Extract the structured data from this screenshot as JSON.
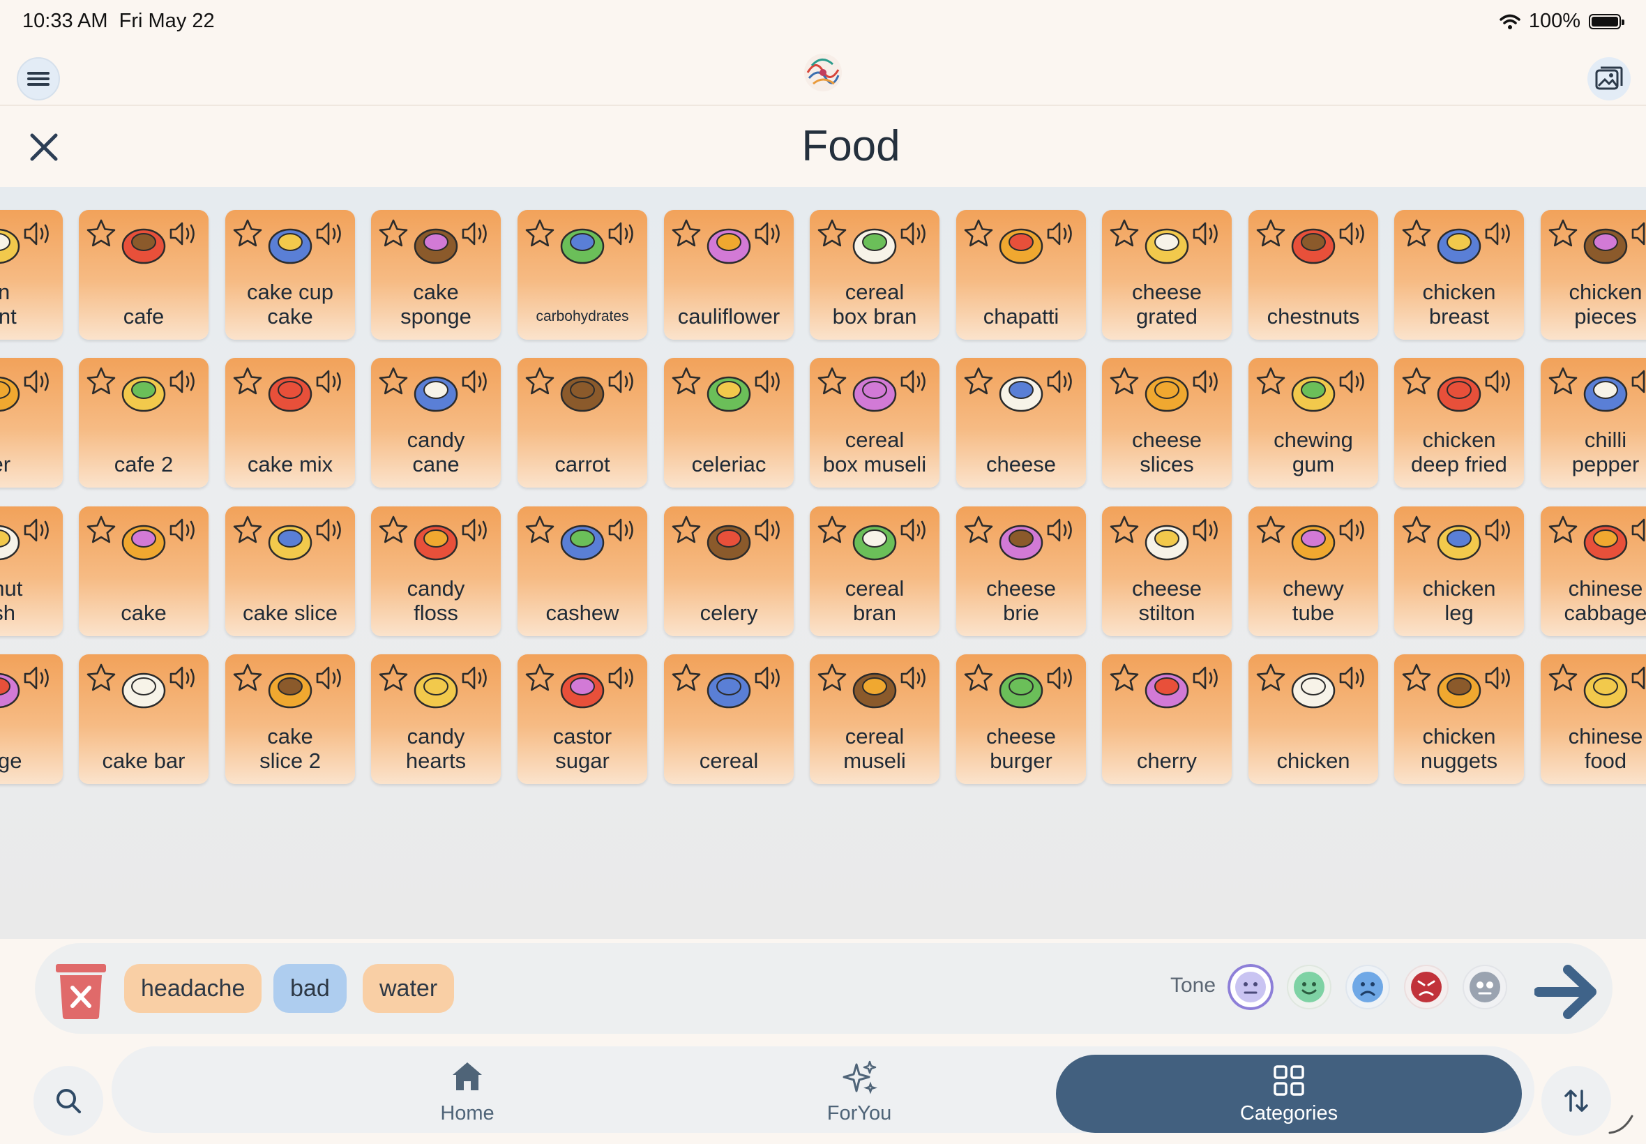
{
  "status": {
    "time": "10:33 AM",
    "date": "Fri May 22",
    "battery": "100%"
  },
  "page": {
    "title": "Food"
  },
  "tiles": [
    [
      "un\nrant",
      "cafe",
      "cake cup\ncake",
      "cake\nsponge",
      "carbohydrates",
      "cauliflower",
      "cereal\nbox bran",
      "chapatti",
      "cheese\ngrated",
      "chestnuts",
      "chicken\nbreast",
      "chicken\npieces"
    ],
    [
      "ter",
      "cafe 2",
      "cake mix",
      "candy\ncane",
      "carrot",
      "celeriac",
      "cereal\nbox museli",
      "cheese",
      "cheese\nslices",
      "chewing\ngum",
      "chicken\ndeep fried",
      "chilli\npepper"
    ],
    [
      "ernut\nash",
      "cake",
      "cake slice",
      "candy\nfloss",
      "cashew",
      "celery",
      "cereal\nbran",
      "cheese\nbrie",
      "cheese\nstilton",
      "chewy\ntube",
      "chicken\nleg",
      "chinese\ncabbage"
    ],
    [
      "bage",
      "cake bar",
      "cake\nslice 2",
      "candy\nhearts",
      "castor\nsugar",
      "cereal",
      "cereal\nmuseli",
      "cheese\nburger",
      "cherry",
      "chicken",
      "chicken\nnuggets",
      "chinese\nfood"
    ]
  ],
  "tile_icons": [
    [
      "food-icon",
      "cafe-icon",
      "cupcake-icon",
      "burger-icon",
      "bread-icon",
      "cauliflower-icon",
      "cereal-box-icon",
      "chapatti-icon",
      "cheese-grated-icon",
      "chestnut-icon",
      "chicken-breast-icon",
      "chicken-pieces-icon"
    ],
    [
      "butter-icon",
      "cafe-icon",
      "cake-mix-icon",
      "candy-cane-icon",
      "carrot-icon",
      "celeriac-icon",
      "cereal-box-icon",
      "cheese-icon",
      "cheese-slices-icon",
      "chewing-gum-icon",
      "fryer-icon",
      "chilli-icon"
    ],
    [
      "squash-icon",
      "cake-icon",
      "cake-slice-icon",
      "candy-floss-icon",
      "cashew-icon",
      "celery-icon",
      "cereal-bowl-icon",
      "brie-icon",
      "stilton-icon",
      "chewy-tube-icon",
      "chicken-leg-icon",
      "cabbage-icon"
    ],
    [
      "lettuce-icon",
      "cake-bar-icon",
      "cake-slice-icon",
      "candy-hearts-icon",
      "sugar-bag-icon",
      "cereal-bowl-icon",
      "muesli-bowl-icon",
      "cheeseburger-icon",
      "cherry-icon",
      "roast-chicken-icon",
      "nuggets-icon",
      "chinese-food-icon"
    ]
  ],
  "sentence": {
    "chips": [
      "headache",
      "bad",
      "water"
    ],
    "chip_colors": [
      "orange",
      "blue",
      "orange"
    ]
  },
  "tone": {
    "label": "Tone",
    "options": [
      "neutral",
      "happy",
      "sad",
      "angry",
      "robot"
    ],
    "selected": "neutral"
  },
  "nav": {
    "home": "Home",
    "foryou": "ForYou",
    "categories": "Categories",
    "active": "Categories"
  },
  "colors": {
    "tile_top": "#f2a25a",
    "tile_bottom": "#fbe3cc",
    "nav_active": "#42607f",
    "send_arrow": "#3f6389",
    "trash": "#e06a6a"
  }
}
